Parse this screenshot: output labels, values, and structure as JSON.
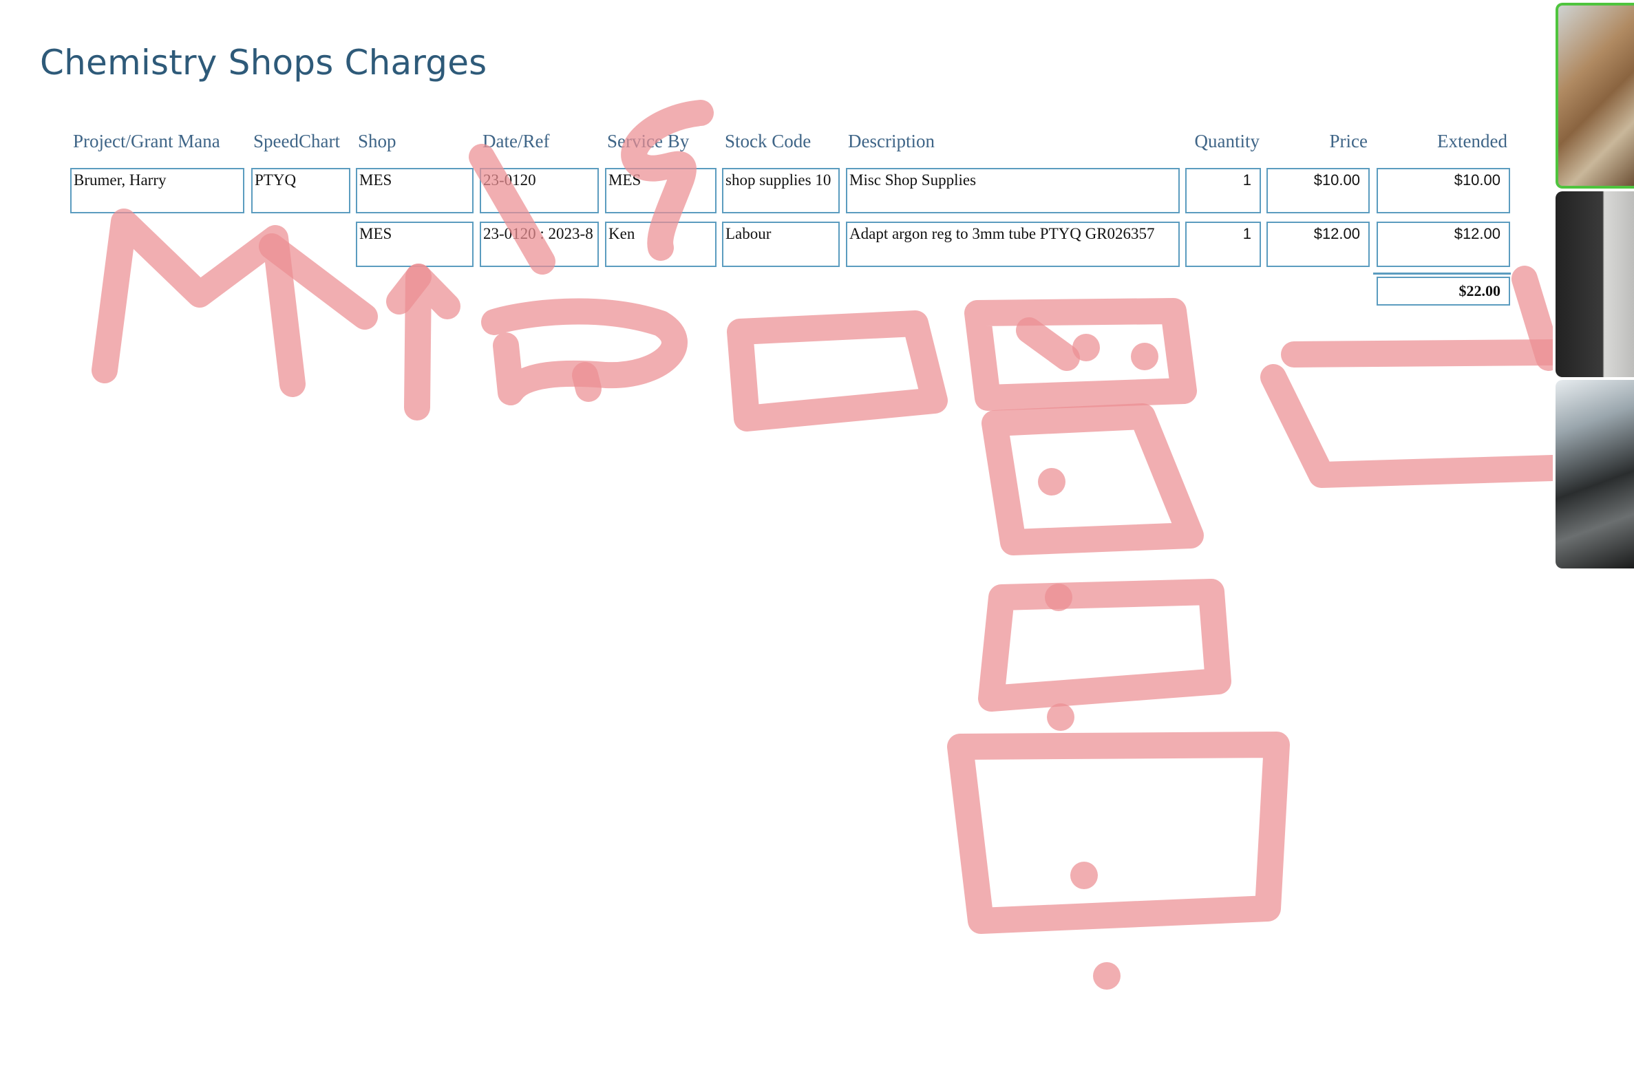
{
  "page": {
    "title": "Chemistry Shops Charges"
  },
  "table": {
    "columns": [
      "Project/Grant Mana",
      "SpeedChart",
      "Shop",
      "Date/Ref",
      "Service By",
      "Stock Code",
      "Description",
      "Quantity",
      "Price",
      "Extended"
    ],
    "rows": [
      {
        "project": "Brumer, Harry",
        "speedchart": "PTYQ",
        "shop": "MES",
        "date_ref": "23-0120",
        "service_by": "MES",
        "stock_code": "shop supplies 10",
        "description": "Misc Shop Supplies",
        "quantity": "1",
        "price": "$10.00",
        "extended": "$10.00"
      },
      {
        "project": "",
        "speedchart": "",
        "shop": "MES",
        "date_ref": "23-0120 : 2023-8",
        "service_by": "Ken",
        "stock_code": "Labour",
        "description": "Adapt argon reg to 3mm tube PTYQ GR026357",
        "quantity": "1",
        "price": "$12.00",
        "extended": "$12.00"
      }
    ],
    "total": "$22.00"
  },
  "annotation": {
    "color": "#ec8f93",
    "tool": "freehand pen"
  },
  "video_strip": {
    "active_border_color": "#4fc43e",
    "tiles": 3
  }
}
